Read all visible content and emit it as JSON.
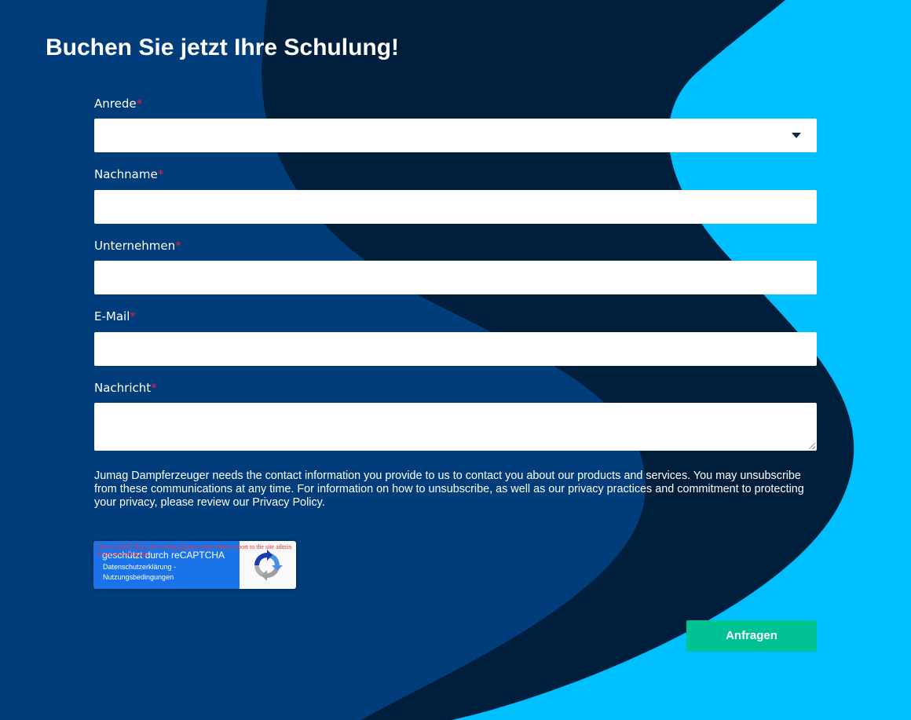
{
  "page": {
    "title": "Buchen Sie jetzt Ihre Schulung!"
  },
  "form": {
    "required_marker": "*",
    "fields": [
      {
        "label": "Anrede",
        "type": "select",
        "value": ""
      },
      {
        "label": "Nachname",
        "type": "text",
        "value": ""
      },
      {
        "label": "Unternehmen",
        "type": "text",
        "value": ""
      },
      {
        "label": "E-Mail",
        "type": "email",
        "value": ""
      },
      {
        "label": "Nachricht",
        "type": "textarea",
        "value": ""
      }
    ],
    "privacy_text": "Jumag Dampferzeuger needs the contact information you provide to us to contact you about our products and services. You may unsubscribe from these communications at any time. For information on how to unsubscribe, as well as our privacy practices and commitment to protecting your privacy, please review our Privacy Policy.",
    "submit_label": "Anfragen"
  },
  "recaptcha": {
    "warning": "This reCAPTCHA is for testing purposes only. Please report to the site admin if you are seeing this.",
    "protected_by": "geschützt durch reCAPTCHA",
    "privacy_link": "Datenschutzerklärung",
    "separator": " - ",
    "terms_link": "Nutzungsbedingungen",
    "icon": "recaptcha-logo-icon"
  },
  "colors": {
    "background_mid": "#003d7a",
    "wave_dark": "#001f3d",
    "wave_light": "#00bfff",
    "required": "#e2243c",
    "submit": "#00c192",
    "recaptcha_blue": "#1a73e8"
  }
}
